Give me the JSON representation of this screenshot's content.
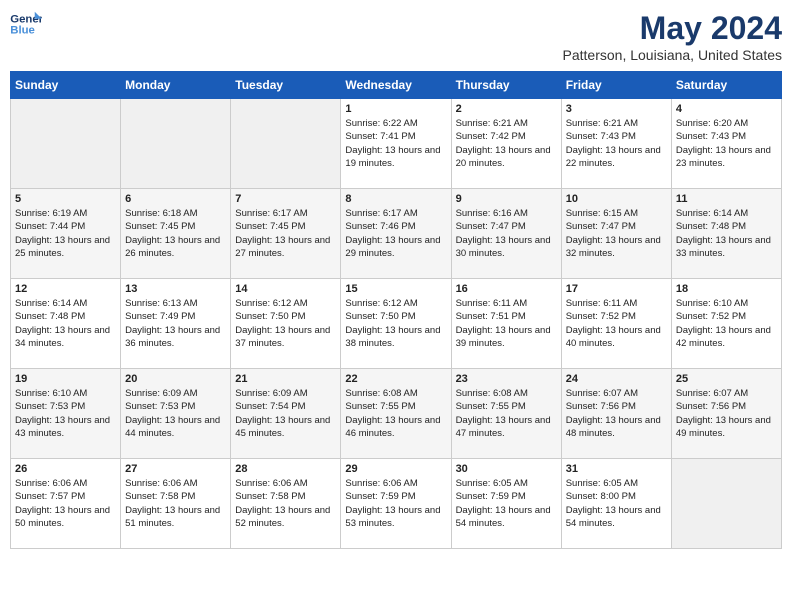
{
  "header": {
    "logo_line1": "General",
    "logo_line2": "Blue",
    "title": "May 2024",
    "subtitle": "Patterson, Louisiana, United States"
  },
  "weekdays": [
    "Sunday",
    "Monday",
    "Tuesday",
    "Wednesday",
    "Thursday",
    "Friday",
    "Saturday"
  ],
  "weeks": [
    [
      {
        "day": "",
        "sunrise": "",
        "sunset": "",
        "daylight": ""
      },
      {
        "day": "",
        "sunrise": "",
        "sunset": "",
        "daylight": ""
      },
      {
        "day": "",
        "sunrise": "",
        "sunset": "",
        "daylight": ""
      },
      {
        "day": "1",
        "sunrise": "Sunrise: 6:22 AM",
        "sunset": "Sunset: 7:41 PM",
        "daylight": "Daylight: 13 hours and 19 minutes."
      },
      {
        "day": "2",
        "sunrise": "Sunrise: 6:21 AM",
        "sunset": "Sunset: 7:42 PM",
        "daylight": "Daylight: 13 hours and 20 minutes."
      },
      {
        "day": "3",
        "sunrise": "Sunrise: 6:21 AM",
        "sunset": "Sunset: 7:43 PM",
        "daylight": "Daylight: 13 hours and 22 minutes."
      },
      {
        "day": "4",
        "sunrise": "Sunrise: 6:20 AM",
        "sunset": "Sunset: 7:43 PM",
        "daylight": "Daylight: 13 hours and 23 minutes."
      }
    ],
    [
      {
        "day": "5",
        "sunrise": "Sunrise: 6:19 AM",
        "sunset": "Sunset: 7:44 PM",
        "daylight": "Daylight: 13 hours and 25 minutes."
      },
      {
        "day": "6",
        "sunrise": "Sunrise: 6:18 AM",
        "sunset": "Sunset: 7:45 PM",
        "daylight": "Daylight: 13 hours and 26 minutes."
      },
      {
        "day": "7",
        "sunrise": "Sunrise: 6:17 AM",
        "sunset": "Sunset: 7:45 PM",
        "daylight": "Daylight: 13 hours and 27 minutes."
      },
      {
        "day": "8",
        "sunrise": "Sunrise: 6:17 AM",
        "sunset": "Sunset: 7:46 PM",
        "daylight": "Daylight: 13 hours and 29 minutes."
      },
      {
        "day": "9",
        "sunrise": "Sunrise: 6:16 AM",
        "sunset": "Sunset: 7:47 PM",
        "daylight": "Daylight: 13 hours and 30 minutes."
      },
      {
        "day": "10",
        "sunrise": "Sunrise: 6:15 AM",
        "sunset": "Sunset: 7:47 PM",
        "daylight": "Daylight: 13 hours and 32 minutes."
      },
      {
        "day": "11",
        "sunrise": "Sunrise: 6:14 AM",
        "sunset": "Sunset: 7:48 PM",
        "daylight": "Daylight: 13 hours and 33 minutes."
      }
    ],
    [
      {
        "day": "12",
        "sunrise": "Sunrise: 6:14 AM",
        "sunset": "Sunset: 7:48 PM",
        "daylight": "Daylight: 13 hours and 34 minutes."
      },
      {
        "day": "13",
        "sunrise": "Sunrise: 6:13 AM",
        "sunset": "Sunset: 7:49 PM",
        "daylight": "Daylight: 13 hours and 36 minutes."
      },
      {
        "day": "14",
        "sunrise": "Sunrise: 6:12 AM",
        "sunset": "Sunset: 7:50 PM",
        "daylight": "Daylight: 13 hours and 37 minutes."
      },
      {
        "day": "15",
        "sunrise": "Sunrise: 6:12 AM",
        "sunset": "Sunset: 7:50 PM",
        "daylight": "Daylight: 13 hours and 38 minutes."
      },
      {
        "day": "16",
        "sunrise": "Sunrise: 6:11 AM",
        "sunset": "Sunset: 7:51 PM",
        "daylight": "Daylight: 13 hours and 39 minutes."
      },
      {
        "day": "17",
        "sunrise": "Sunrise: 6:11 AM",
        "sunset": "Sunset: 7:52 PM",
        "daylight": "Daylight: 13 hours and 40 minutes."
      },
      {
        "day": "18",
        "sunrise": "Sunrise: 6:10 AM",
        "sunset": "Sunset: 7:52 PM",
        "daylight": "Daylight: 13 hours and 42 minutes."
      }
    ],
    [
      {
        "day": "19",
        "sunrise": "Sunrise: 6:10 AM",
        "sunset": "Sunset: 7:53 PM",
        "daylight": "Daylight: 13 hours and 43 minutes."
      },
      {
        "day": "20",
        "sunrise": "Sunrise: 6:09 AM",
        "sunset": "Sunset: 7:53 PM",
        "daylight": "Daylight: 13 hours and 44 minutes."
      },
      {
        "day": "21",
        "sunrise": "Sunrise: 6:09 AM",
        "sunset": "Sunset: 7:54 PM",
        "daylight": "Daylight: 13 hours and 45 minutes."
      },
      {
        "day": "22",
        "sunrise": "Sunrise: 6:08 AM",
        "sunset": "Sunset: 7:55 PM",
        "daylight": "Daylight: 13 hours and 46 minutes."
      },
      {
        "day": "23",
        "sunrise": "Sunrise: 6:08 AM",
        "sunset": "Sunset: 7:55 PM",
        "daylight": "Daylight: 13 hours and 47 minutes."
      },
      {
        "day": "24",
        "sunrise": "Sunrise: 6:07 AM",
        "sunset": "Sunset: 7:56 PM",
        "daylight": "Daylight: 13 hours and 48 minutes."
      },
      {
        "day": "25",
        "sunrise": "Sunrise: 6:07 AM",
        "sunset": "Sunset: 7:56 PM",
        "daylight": "Daylight: 13 hours and 49 minutes."
      }
    ],
    [
      {
        "day": "26",
        "sunrise": "Sunrise: 6:06 AM",
        "sunset": "Sunset: 7:57 PM",
        "daylight": "Daylight: 13 hours and 50 minutes."
      },
      {
        "day": "27",
        "sunrise": "Sunrise: 6:06 AM",
        "sunset": "Sunset: 7:58 PM",
        "daylight": "Daylight: 13 hours and 51 minutes."
      },
      {
        "day": "28",
        "sunrise": "Sunrise: 6:06 AM",
        "sunset": "Sunset: 7:58 PM",
        "daylight": "Daylight: 13 hours and 52 minutes."
      },
      {
        "day": "29",
        "sunrise": "Sunrise: 6:06 AM",
        "sunset": "Sunset: 7:59 PM",
        "daylight": "Daylight: 13 hours and 53 minutes."
      },
      {
        "day": "30",
        "sunrise": "Sunrise: 6:05 AM",
        "sunset": "Sunset: 7:59 PM",
        "daylight": "Daylight: 13 hours and 54 minutes."
      },
      {
        "day": "31",
        "sunrise": "Sunrise: 6:05 AM",
        "sunset": "Sunset: 8:00 PM",
        "daylight": "Daylight: 13 hours and 54 minutes."
      },
      {
        "day": "",
        "sunrise": "",
        "sunset": "",
        "daylight": ""
      }
    ]
  ]
}
